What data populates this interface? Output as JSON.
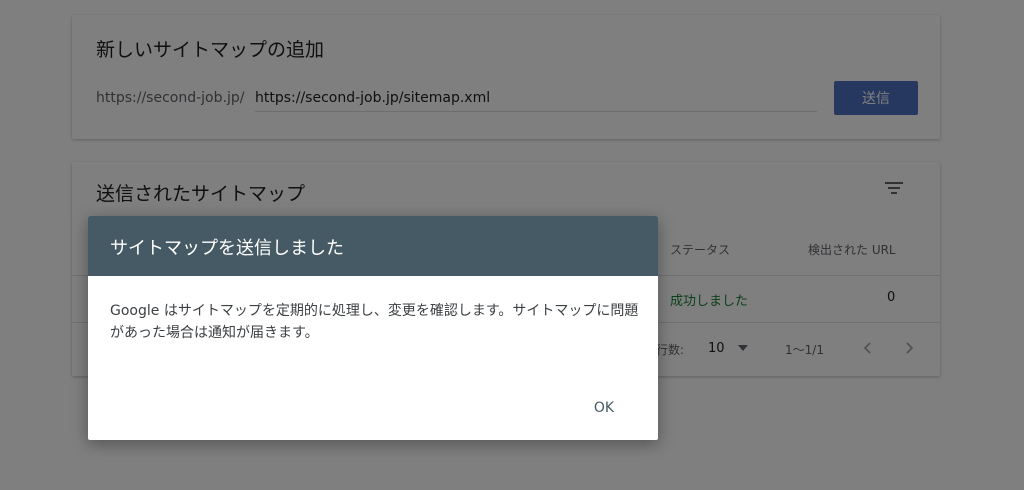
{
  "add_sitemap": {
    "title": "新しいサイトマップの追加",
    "url_prefix": "https://second-job.jp/",
    "url_value": "https://second-job.jp/sitemap.xml",
    "submit_label": "送信"
  },
  "submitted_sitemaps": {
    "title": "送信されたサイトマップ",
    "columns": {
      "status": "ステータス",
      "detected_urls": "検出された URL"
    },
    "rows": [
      {
        "status": "成功しました",
        "detected_urls": "0"
      }
    ],
    "pagination": {
      "rows_label": "行数:",
      "rows_per_page": "10",
      "range": "1〜1/1"
    }
  },
  "dialog": {
    "title": "サイトマップを送信しました",
    "body": "Google はサイトマップを定期的に処理し、変更を確認します。サイトマップに問題があった場合は通知が届きます。",
    "ok_label": "OK"
  },
  "colors": {
    "primary_button": "#4c70c0",
    "dialog_header": "#455a64",
    "success": "#188038"
  },
  "icons": [
    "filter-icon",
    "dropdown-arrow-icon",
    "chevron-left-icon",
    "chevron-right-icon"
  ]
}
